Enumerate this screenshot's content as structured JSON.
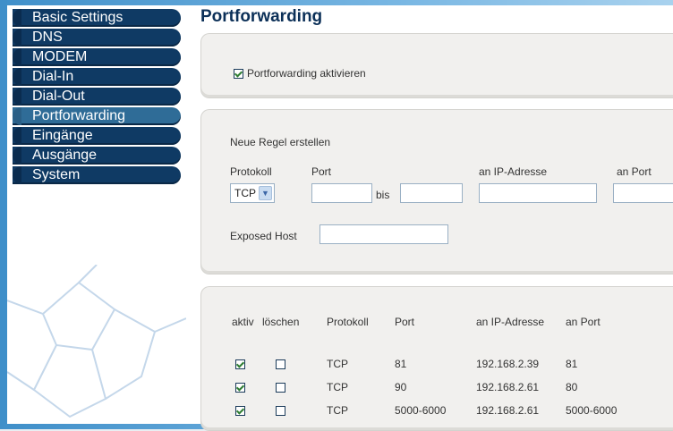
{
  "sidebar": {
    "items": [
      {
        "label": "Basic Settings"
      },
      {
        "label": "DNS"
      },
      {
        "label": "MODEM"
      },
      {
        "label": "Dial-In"
      },
      {
        "label": "Dial-Out"
      },
      {
        "label": "Portforwarding",
        "active": true
      },
      {
        "label": "Eingänge"
      },
      {
        "label": "Ausgänge"
      },
      {
        "label": "System"
      }
    ]
  },
  "page": {
    "title": "Portforwarding"
  },
  "enable": {
    "label": "Portforwarding aktivieren",
    "checked": true
  },
  "new_rule": {
    "heading": "Neue Regel erstellen",
    "col_protokoll": "Protokoll",
    "col_port": "Port",
    "col_ip": "an IP-Adresse",
    "col_an_port": "an Port",
    "protocol_value": "TCP",
    "bis_label": "bis",
    "exposed_host_label": "Exposed Host"
  },
  "rules": {
    "headers": {
      "aktiv": "aktiv",
      "loeschen": "löschen",
      "protokoll": "Protokoll",
      "port": "Port",
      "ip": "an IP-Adresse",
      "an_port": "an Port"
    },
    "rows": [
      {
        "aktiv": true,
        "loeschen": false,
        "protokoll": "TCP",
        "port": "81",
        "ip": "192.168.2.39",
        "an_port": "81"
      },
      {
        "aktiv": true,
        "loeschen": false,
        "protokoll": "TCP",
        "port": "90",
        "ip": "192.168.2.61",
        "an_port": "80"
      },
      {
        "aktiv": true,
        "loeschen": false,
        "protokoll": "TCP",
        "port": "5000-6000",
        "ip": "192.168.2.61",
        "an_port": "5000-6000"
      }
    ]
  },
  "colors": {
    "nav_bg": "#0f3a64",
    "nav_active_bg": "#2f6c97",
    "title": "#0c3058",
    "frame": "#3f8fc9"
  }
}
